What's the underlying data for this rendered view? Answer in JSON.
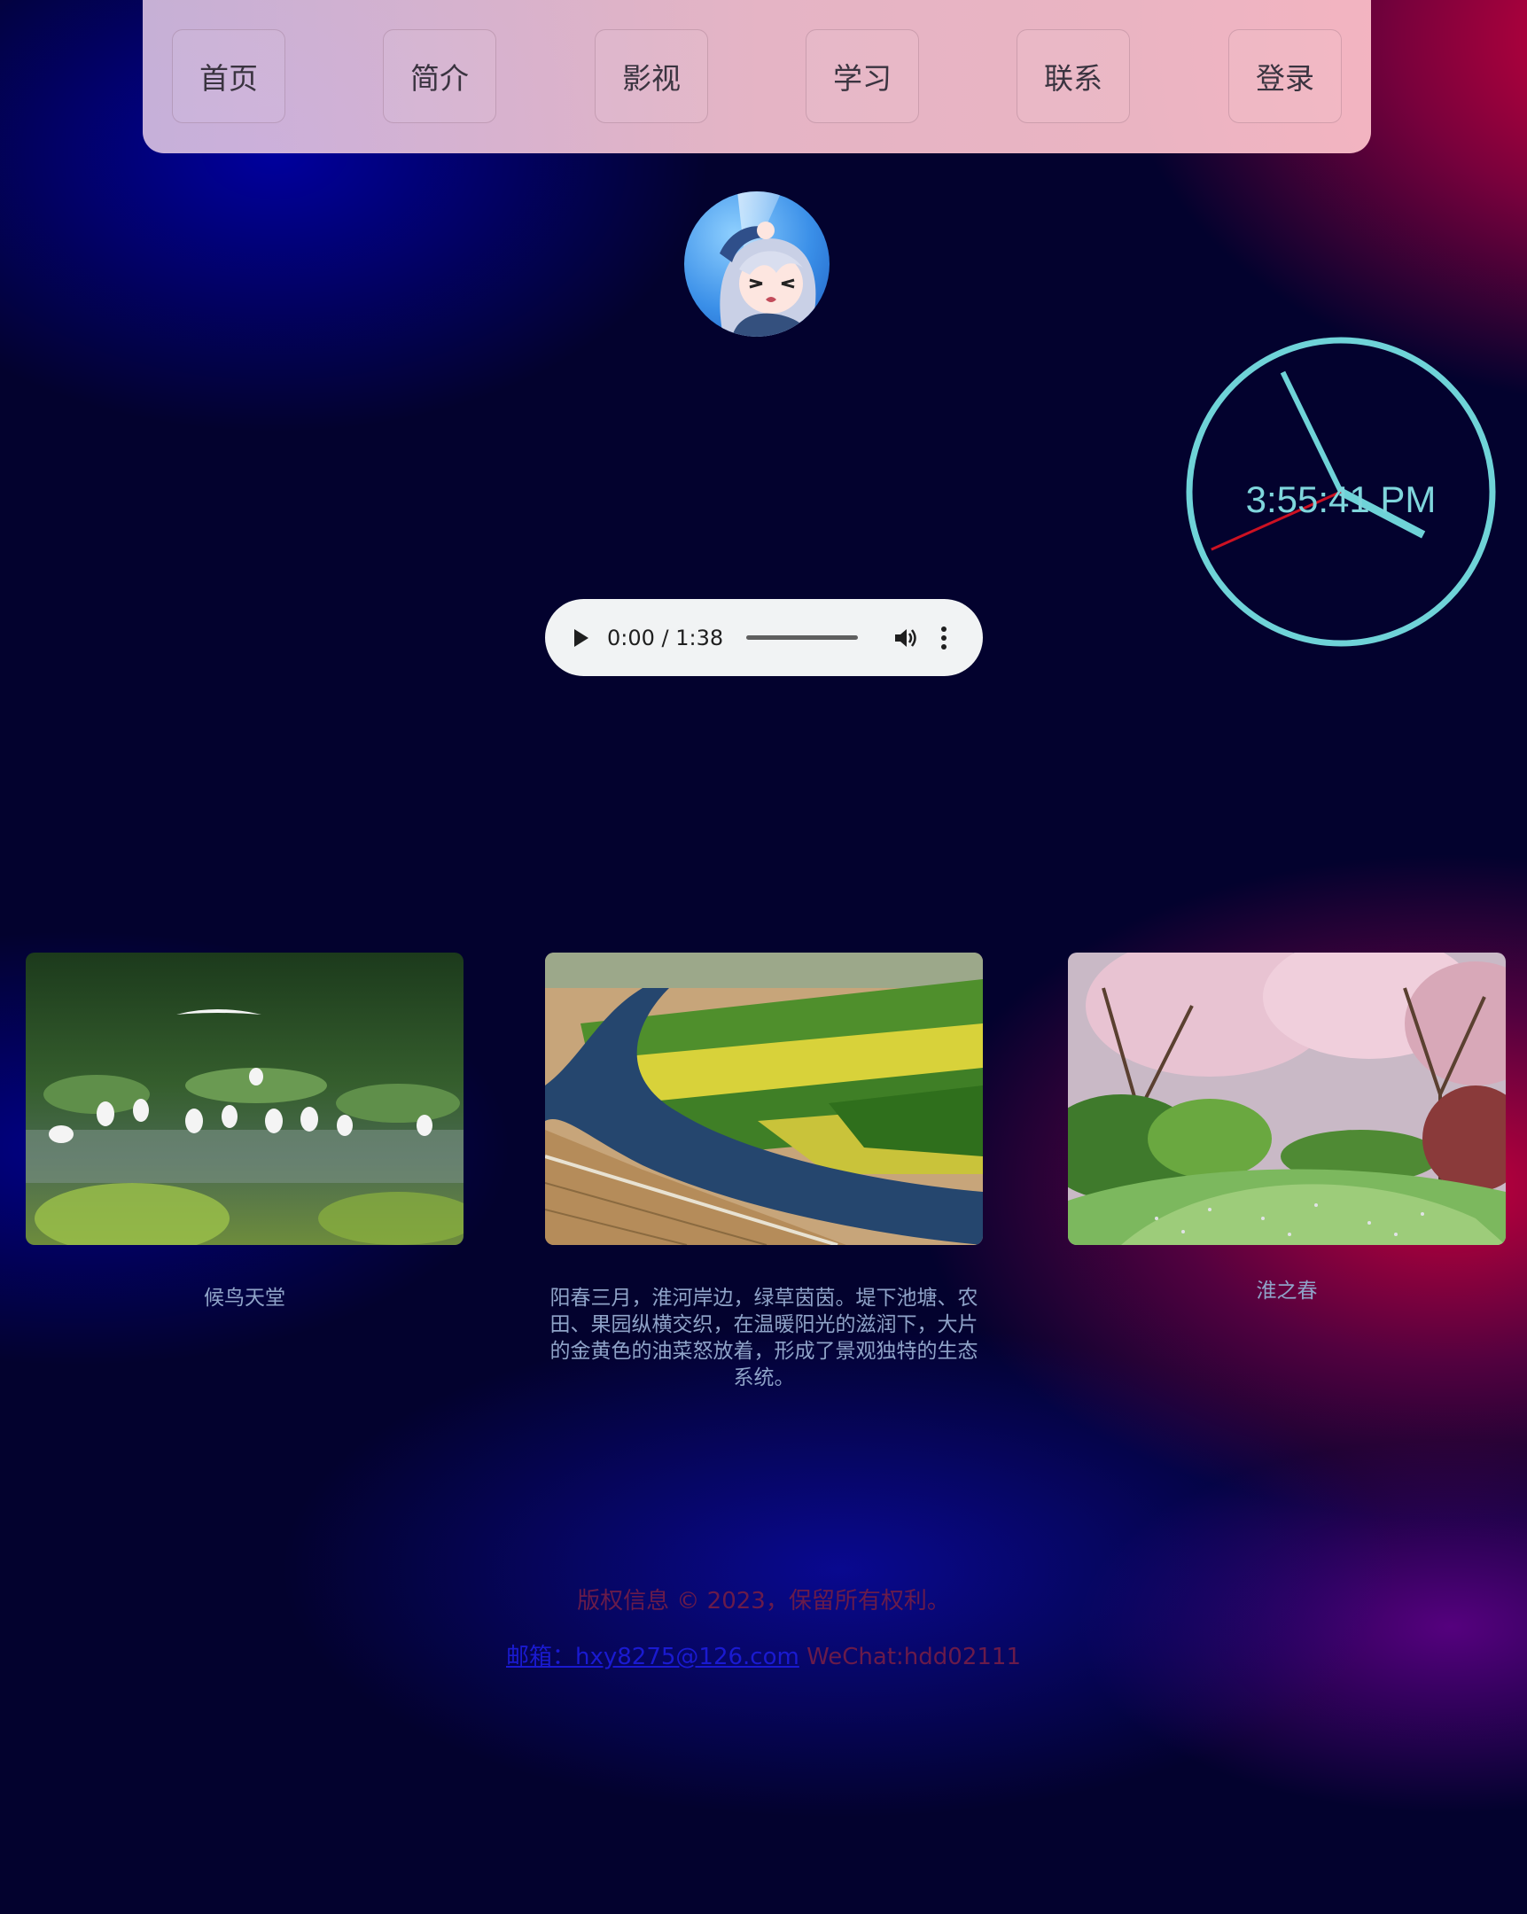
{
  "nav": {
    "items": [
      {
        "label": "首页"
      },
      {
        "label": "简介"
      },
      {
        "label": "影视"
      },
      {
        "label": "学习"
      },
      {
        "label": "联系"
      },
      {
        "label": "登录"
      }
    ]
  },
  "clock": {
    "time": "3:55:41 PM",
    "color": "#6fd3d8"
  },
  "audio": {
    "time_display": "0:00 / 1:38",
    "progress": 0
  },
  "gallery": [
    {
      "caption": "候鸟天堂",
      "image": "egrets-wetland"
    },
    {
      "caption": "阳春三月，淮河岸边，绿草茵茵。堤下池塘、农田、果园纵横交织，在温暖阳光的滋润下，大片的金黄色的油菜怒放着，形成了景观独特的生态系统。",
      "image": "river-farmland-aerial"
    },
    {
      "caption": "淮之春",
      "image": "spring-garden-path"
    }
  ],
  "footer": {
    "copyright": "版权信息 © 2023，保留所有权利。",
    "email_link": "邮箱：hxy8275@126.com",
    "wechat": "WeChat:hdd02111"
  }
}
